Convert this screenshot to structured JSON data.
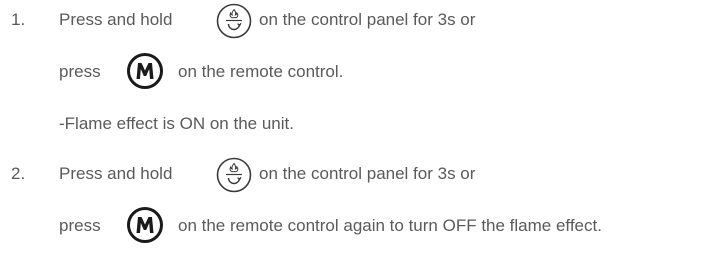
{
  "steps": [
    {
      "number": "1.",
      "line1_before": "Press and hold",
      "line1_after": "on the control panel for 3s or",
      "line2_before": "press",
      "line2_after": "on the remote control.",
      "note": "-Flame effect is ON on the unit."
    },
    {
      "number": "2.",
      "line1_before": "Press and hold",
      "line1_after": "on the control panel for 3s or",
      "line2_before": "press",
      "line2_after": "on the remote control again to turn OFF the flame effect."
    }
  ],
  "icons": {
    "panel_button": "flame-cycle-icon",
    "remote_button": "flame-effect-remote-icon"
  },
  "colors": {
    "text": "#5a5a5a",
    "icon_stroke": "#3a3a3a",
    "icon_fill": "#1a1a1a"
  }
}
